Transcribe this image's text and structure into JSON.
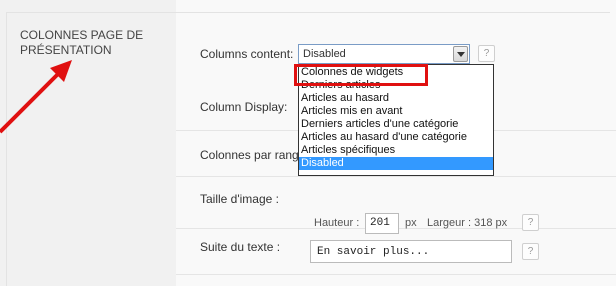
{
  "section": {
    "title": "COLONNES PAGE DE PRÉSENTATION"
  },
  "fields": {
    "columns_content": {
      "label": "Columns content:",
      "selected": "Disabled",
      "options": [
        "Colonnes de widgets",
        "Derniers articles",
        "Articles au hasard",
        "Articles mis en avant",
        "Derniers articles d'une catégorie",
        "Articles au hasard d'une catégorie",
        "Articles spécifiques",
        "Disabled"
      ]
    },
    "column_display": {
      "label": "Column Display:"
    },
    "colonnes_par_rang": {
      "label": "Colonnes par rang"
    },
    "taille_image": {
      "label": "Taille d'image :",
      "hauteur_label": "Hauteur :",
      "hauteur_value": "201",
      "px_unit": "px",
      "largeur_text": "Largeur : 318 px"
    },
    "suite_texte": {
      "label": "Suite du texte :",
      "value": "En savoir plus..."
    }
  },
  "help_label": "?",
  "annotation": {
    "arrow_color": "#e01010",
    "highlight_color": "#e01010"
  }
}
